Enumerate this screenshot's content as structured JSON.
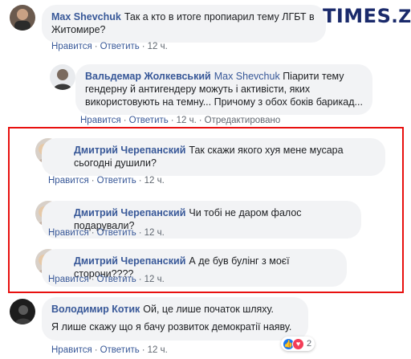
{
  "logo": {
    "text": "TIMES.ZT"
  },
  "labels": {
    "like": "Нравится",
    "reply": "Ответить",
    "edited": "Отредактировано"
  },
  "comments": [
    {
      "author": "Max Shevchuk",
      "text": "Так а кто в итоге пропиарил тему ЛГБТ в Житомире?",
      "time": "12 ч."
    },
    {
      "author": "Вальдемар Жолкевський",
      "mention": "Max Shevchuk",
      "text": "Піарити тему гендерну й антигендеру можуть і активісти, яких використовують на темну... Причому з обох боків барикад...",
      "time": "12 ч."
    },
    {
      "author": "Дмитрий Черепанский",
      "text": "Так скажи якого хуя мене мусара сьогодні душили?",
      "time": "12 ч."
    },
    {
      "author": "Дмитрий Черепанский",
      "text": "Чи тобі не даром фалос подарували?",
      "time": "12 ч."
    },
    {
      "author": "Дмитрий Черепанский",
      "text": "А де був булінг з моєї сторони????",
      "time": "12 ч."
    },
    {
      "author": "Володимир Котик",
      "text": "Ой, це лише початок шляху.",
      "text2": "Я лише скажу що я бачу розвиток демократії наяву.",
      "time": "12 ч.",
      "reactions": "2"
    }
  ]
}
